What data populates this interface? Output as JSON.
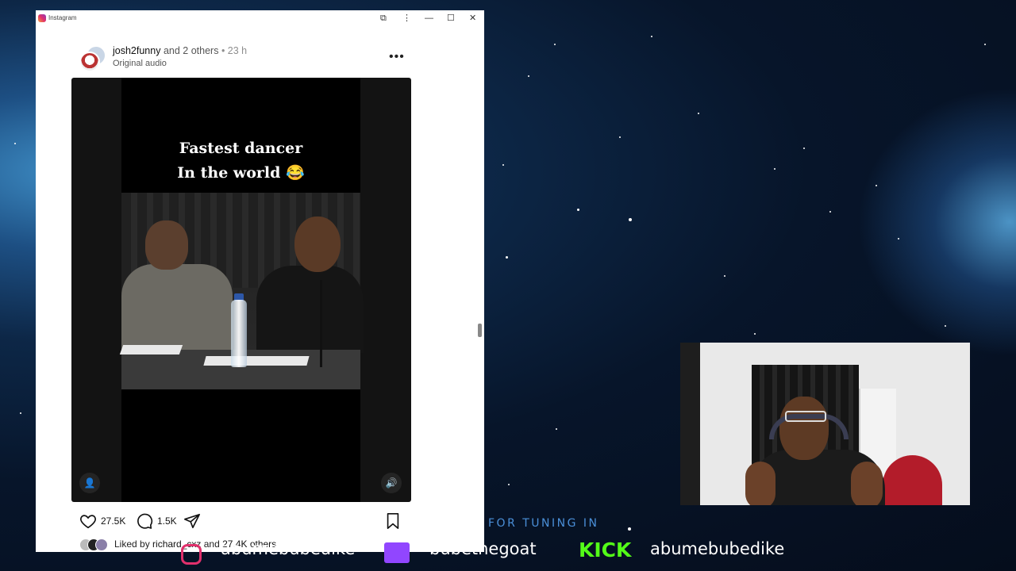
{
  "window": {
    "title": "Instagram",
    "controls": {
      "extensions_icon": "puzzle-icon",
      "menu_icon": "kebab-icon",
      "minimize": "—",
      "maximize": "☐",
      "close": "✕"
    }
  },
  "post": {
    "author": "josh2funny",
    "coauthors": "and 2 others",
    "time": "• 23 h",
    "audio": "Original audio",
    "more_icon": "•••",
    "video_caption_line1": "Fastest dancer",
    "video_caption_line2": "In the world 😂",
    "likes": "27.5K",
    "comments": "1.5K",
    "liked_by_prefix": "Liked by",
    "liked_by_user": "richard_cxz",
    "liked_by_suffix": "and",
    "liked_by_others": "27.4K others"
  },
  "overlay": {
    "tuning_text": "FOR TUNING IN",
    "instagram_handle": "abumebubedike",
    "twitch_handle": "bubethegoat",
    "kick_label": "KICK",
    "kick_handle": "abumebubedike"
  },
  "colors": {
    "accent_blue": "#4a8fd8",
    "kick_green": "#53fc18",
    "twitch_purple": "#9146ff"
  }
}
